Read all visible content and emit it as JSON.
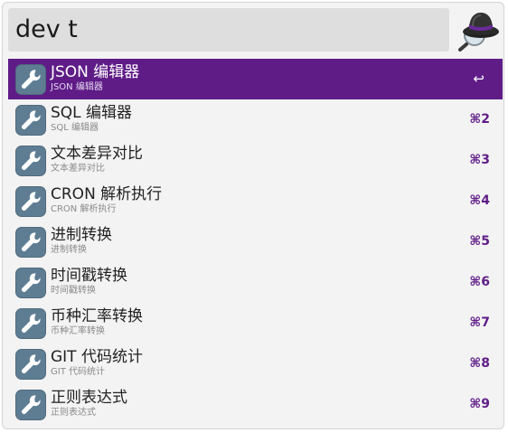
{
  "search": {
    "query": "dev t"
  },
  "colors": {
    "accent": "#5f1c87",
    "icon_bg": "#5e7d93",
    "window_bg": "#f3f3f3"
  },
  "results": [
    {
      "title": "JSON 编辑器",
      "subtitle": "JSON 编辑器",
      "shortcut": "↩",
      "icon": "wrench-icon",
      "selected": true
    },
    {
      "title": "SQL 编辑器",
      "subtitle": "SQL 编辑器",
      "shortcut": "⌘2",
      "icon": "wrench-icon"
    },
    {
      "title": "文本差异对比",
      "subtitle": "文本差异对比",
      "shortcut": "⌘3",
      "icon": "wrench-icon"
    },
    {
      "title": "CRON 解析执行",
      "subtitle": "CRON 解析执行",
      "shortcut": "⌘4",
      "icon": "wrench-icon"
    },
    {
      "title": "进制转换",
      "subtitle": "进制转换",
      "shortcut": "⌘5",
      "icon": "wrench-icon"
    },
    {
      "title": "时间戳转换",
      "subtitle": "时间戳转换",
      "shortcut": "⌘6",
      "icon": "wrench-icon"
    },
    {
      "title": "币种汇率转换",
      "subtitle": "币种汇率转换",
      "shortcut": "⌘7",
      "icon": "wrench-icon"
    },
    {
      "title": "GIT 代码统计",
      "subtitle": "GIT 代码统计",
      "shortcut": "⌘8",
      "icon": "wrench-icon"
    },
    {
      "title": "正则表达式",
      "subtitle": "正则表达式",
      "shortcut": "⌘9",
      "icon": "wrench-icon"
    }
  ]
}
